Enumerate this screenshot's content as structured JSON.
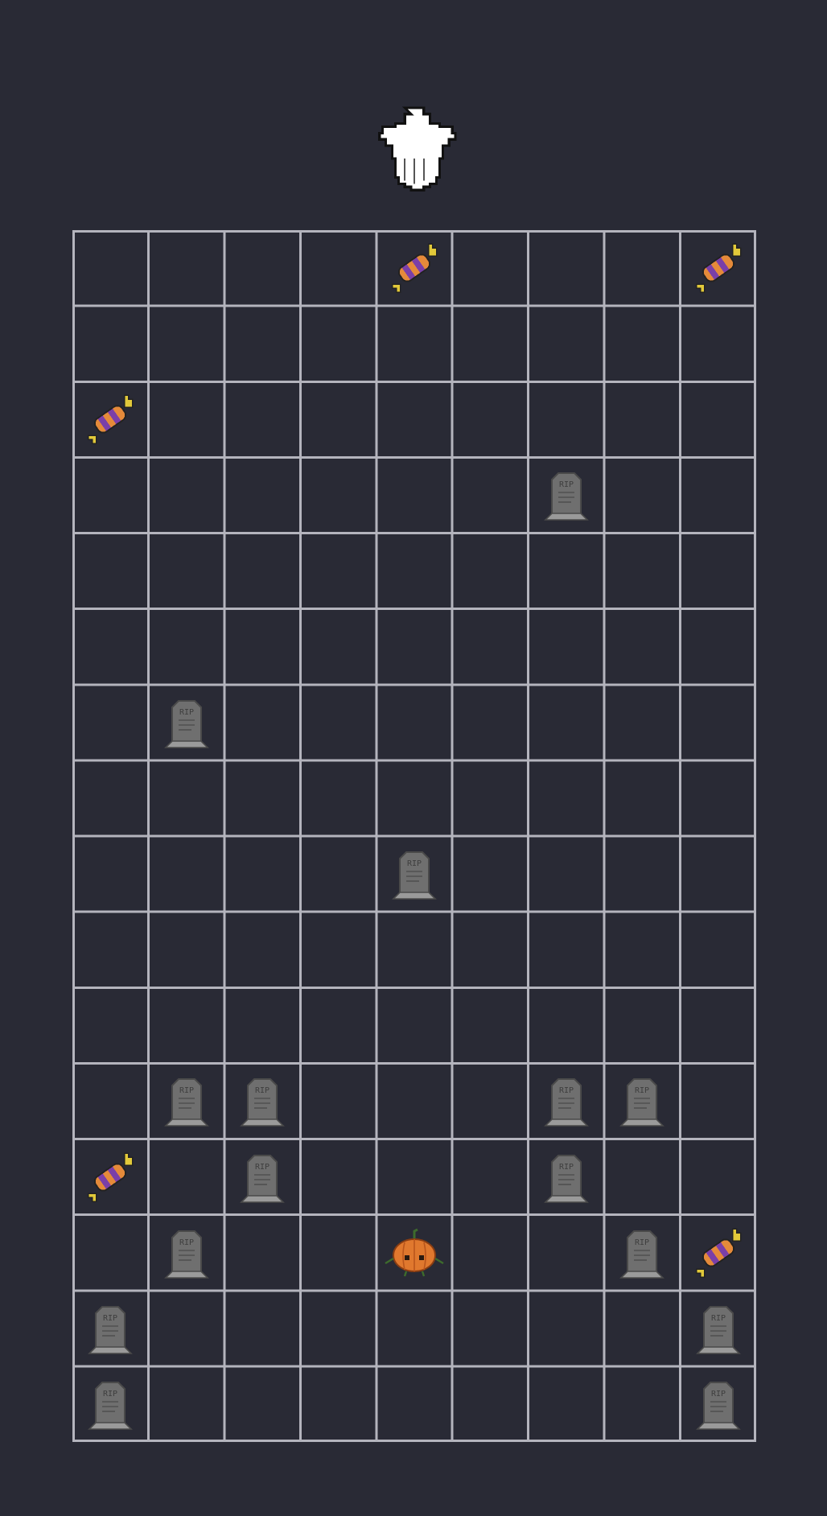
{
  "game": {
    "board": {
      "cols": 9,
      "rows": 16
    },
    "player": {
      "name": "ghost",
      "icon": "ghost-icon",
      "col": 4,
      "color": "#ffffff"
    },
    "cells": [
      {
        "row": 0,
        "col": 4,
        "item": "candy"
      },
      {
        "row": 0,
        "col": 8,
        "item": "candy"
      },
      {
        "row": 2,
        "col": 0,
        "item": "candy"
      },
      {
        "row": 3,
        "col": 6,
        "item": "tombstone"
      },
      {
        "row": 6,
        "col": 1,
        "item": "tombstone"
      },
      {
        "row": 8,
        "col": 4,
        "item": "tombstone"
      },
      {
        "row": 11,
        "col": 1,
        "item": "tombstone"
      },
      {
        "row": 11,
        "col": 2,
        "item": "tombstone"
      },
      {
        "row": 11,
        "col": 6,
        "item": "tombstone"
      },
      {
        "row": 11,
        "col": 7,
        "item": "tombstone"
      },
      {
        "row": 12,
        "col": 0,
        "item": "candy"
      },
      {
        "row": 12,
        "col": 2,
        "item": "tombstone"
      },
      {
        "row": 12,
        "col": 6,
        "item": "tombstone"
      },
      {
        "row": 13,
        "col": 1,
        "item": "tombstone"
      },
      {
        "row": 13,
        "col": 4,
        "item": "pumpkin"
      },
      {
        "row": 13,
        "col": 7,
        "item": "tombstone"
      },
      {
        "row": 13,
        "col": 8,
        "item": "candy"
      },
      {
        "row": 14,
        "col": 0,
        "item": "tombstone"
      },
      {
        "row": 14,
        "col": 8,
        "item": "tombstone"
      },
      {
        "row": 15,
        "col": 0,
        "item": "tombstone"
      },
      {
        "row": 15,
        "col": 8,
        "item": "tombstone"
      }
    ],
    "tombstone_text": "RIP",
    "colors": {
      "background": "#292a35",
      "grid": "#b4b4bd",
      "tombstone": "#6f6f6f",
      "pumpkin": "#e0782e",
      "candy_purple": "#7a3fa8",
      "candy_orange": "#e58a3a",
      "candy_gold": "#e2c93a"
    }
  }
}
